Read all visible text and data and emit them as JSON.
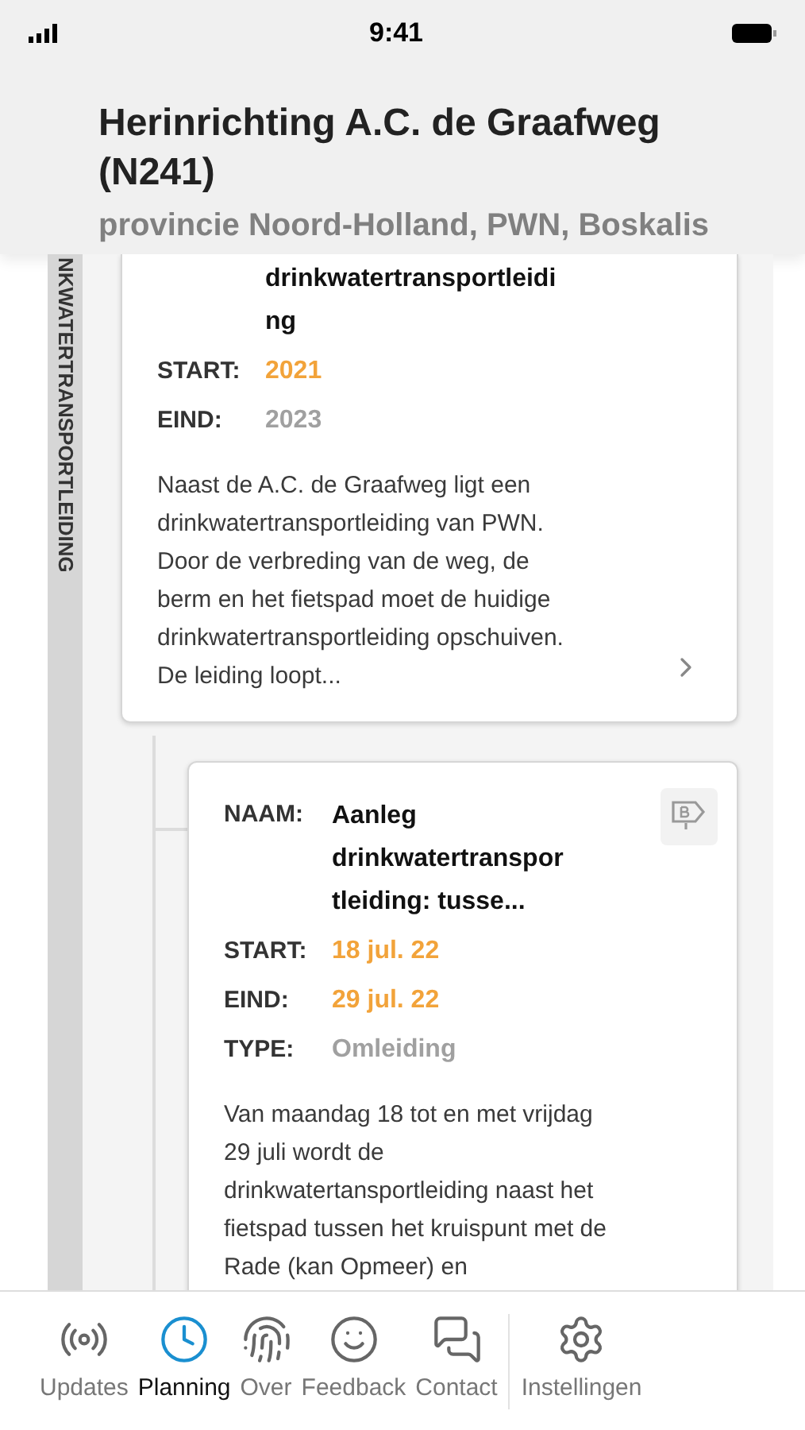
{
  "status_bar": {
    "time": "9:41"
  },
  "header": {
    "title": "Herinrichting A.C. de Graafweg (N241)",
    "subtitle": "provincie Noord-Holland, PWN, Boskalis"
  },
  "section_label": "NKWATERTRANSPORTLEIDING",
  "cards": [
    {
      "name_lines": [
        "drinkwatertransportleidi",
        "ng"
      ],
      "fields": [
        {
          "label": "START:",
          "value": "2021",
          "highlight": true
        },
        {
          "label": "EIND:",
          "value": "2023",
          "highlight": false
        }
      ],
      "description": "Naast de A.C. de Graafweg ligt een drinkwatertransportleiding van PWN. Door de verbreding van de weg, de berm en het fietspad moet de huidige drinkwatertransportleiding opschuiven. De leiding loopt...",
      "badge": false,
      "chevron": true,
      "nested": false
    },
    {
      "name_label": "NAAM:",
      "name_lines": [
        "Aanleg",
        "drinkwatertranspor",
        "tleiding: tusse..."
      ],
      "fields": [
        {
          "label": "START:",
          "value": "18 jul. 22",
          "highlight": true
        },
        {
          "label": "EIND:",
          "value": "29 jul. 22",
          "highlight": true
        },
        {
          "label": "TYPE:",
          "value": "Omleiding",
          "highlight": false
        }
      ],
      "description": "Van maandag 18 tot en met vrijdag 29 juli wordt de drinkwatertansportleiding naast het fietspad tussen het kruispunt met de Rade (kan Opmeer) en",
      "badge": true,
      "chevron": false,
      "nested": true
    }
  ],
  "tabs": [
    {
      "label": "Updates",
      "kind": "broadcast",
      "selected": false
    },
    {
      "label": "Planning",
      "kind": "clock",
      "selected": true
    },
    {
      "label": "Over",
      "kind": "fingerprint",
      "selected": false
    },
    {
      "label": "Feedback",
      "kind": "smile",
      "selected": false
    },
    {
      "label": "Contact",
      "kind": "chat",
      "selected": false
    },
    {
      "label": "Instellingen",
      "kind": "gear",
      "selected": false
    }
  ]
}
